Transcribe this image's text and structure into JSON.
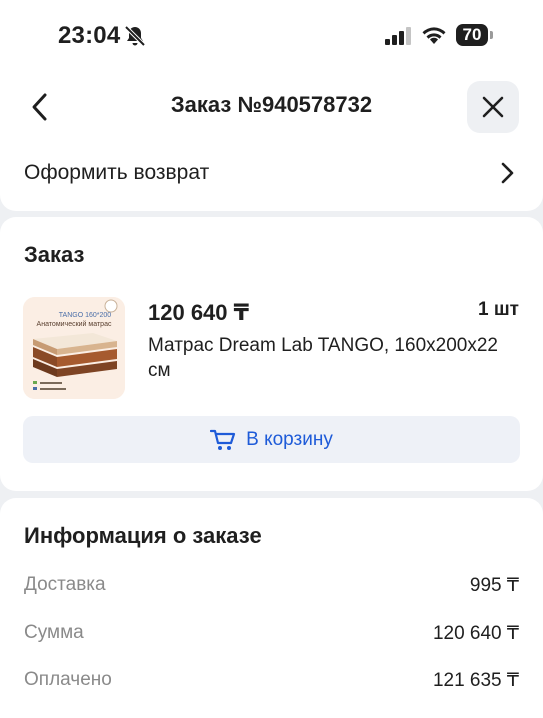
{
  "status_bar": {
    "time": "23:04",
    "battery": "70"
  },
  "header": {
    "title": "Заказ №940578732"
  },
  "return": {
    "label": "Оформить возврат"
  },
  "order": {
    "section_title": "Заказ",
    "product": {
      "image_text_model": "TANGO 160*200",
      "image_text_type": "Анатомический матрас",
      "price": "120 640 ₸",
      "quantity": "1 шт",
      "name": "Матрас Dream Lab TANGO, 160x200x22 см"
    },
    "cart_button_label": "В корзину"
  },
  "info": {
    "title": "Информация о заказе",
    "rows": [
      {
        "label": "Доставка",
        "value": "995 ₸"
      },
      {
        "label": "Сумма",
        "value": "120 640 ₸"
      },
      {
        "label": "Оплачено",
        "value": "121 635 ₸"
      }
    ]
  },
  "colors": {
    "accent": "#1e5bd8",
    "background": "#eef0f3",
    "muted_text": "#8a8a8a"
  },
  "icons": [
    "bell-off-icon",
    "signal-icon",
    "wifi-icon",
    "battery-icon",
    "back-icon",
    "close-icon",
    "chevron-right-icon",
    "cart-icon"
  ]
}
